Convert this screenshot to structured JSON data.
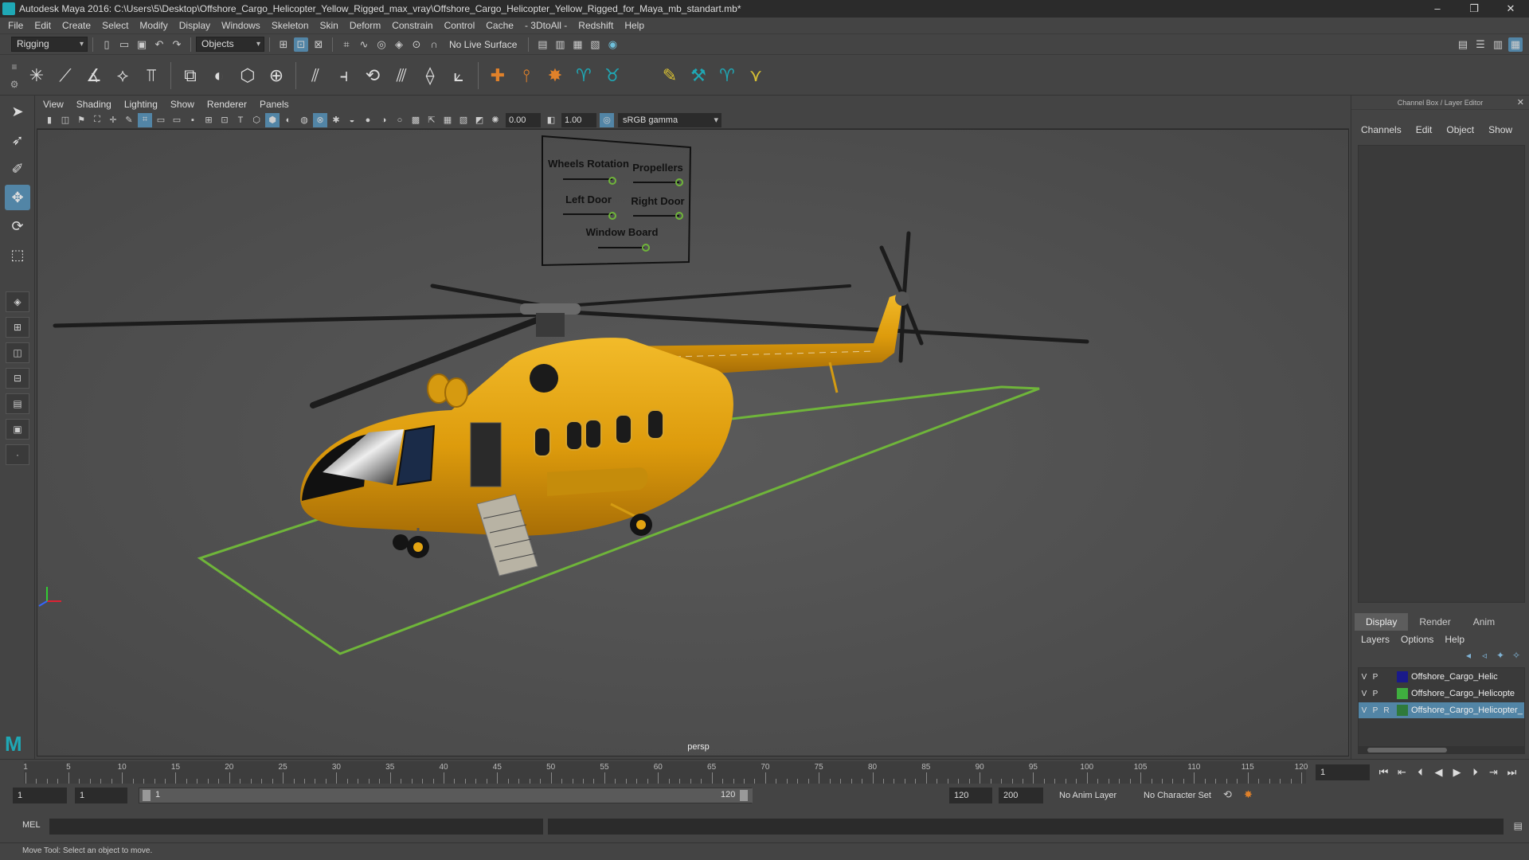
{
  "window": {
    "title": "Autodesk Maya 2016: C:\\Users\\5\\Desktop\\Offshore_Cargo_Helicopter_Yellow_Rigged_max_vray\\Offshore_Cargo_Helicopter_Yellow_Rigged_for_Maya_mb_standart.mb*",
    "minimize": "–",
    "maximize": "❐",
    "close": "✕"
  },
  "menus": [
    "File",
    "Edit",
    "Create",
    "Select",
    "Modify",
    "Display",
    "Windows",
    "Skeleton",
    "Skin",
    "Deform",
    "Constrain",
    "Control",
    "Cache",
    "- 3DtoAll -",
    "Redshift",
    "Help"
  ],
  "statusline": {
    "menuset": "Rigging",
    "selection_mode": "Objects",
    "live_surface": "No Live Surface"
  },
  "panel": {
    "menus": [
      "View",
      "Shading",
      "Lighting",
      "Show",
      "Renderer",
      "Panels"
    ],
    "exposure": "0.00",
    "gamma": "1.00",
    "colorspace": "sRGB gamma",
    "camera": "persp"
  },
  "controls_board": {
    "labels": [
      "Wheels Rotation",
      "Propellers",
      "Left Door",
      "Right Door",
      "Window Board"
    ]
  },
  "channel_box": {
    "header": "Channel Box / Layer Editor",
    "menus": [
      "Channels",
      "Edit",
      "Object",
      "Show"
    ]
  },
  "layer_editor": {
    "tabs": [
      "Display",
      "Render",
      "Anim"
    ],
    "active_tab": "Display",
    "menus": [
      "Layers",
      "Options",
      "Help"
    ],
    "layers": [
      {
        "v": "V",
        "p": "P",
        "r": "",
        "name": "Offshore_Cargo_Helic",
        "color": "#1a1a8a",
        "selected": false
      },
      {
        "v": "V",
        "p": "P",
        "r": "",
        "name": "Offshore_Cargo_Helicopte",
        "color": "#3fae3f",
        "selected": false
      },
      {
        "v": "V",
        "p": "P",
        "r": "R",
        "name": "Offshore_Cargo_Helicopter_",
        "color": "#2f7a3c",
        "selected": true
      }
    ]
  },
  "timeline": {
    "start": 1,
    "end": 120,
    "tick_labels": [
      "1",
      "5",
      "10",
      "15",
      "20",
      "25",
      "30",
      "35",
      "40",
      "45",
      "50",
      "55",
      "60",
      "65",
      "70",
      "75",
      "80",
      "85",
      "90",
      "95",
      "100",
      "105",
      "110",
      "115",
      "120"
    ],
    "current_frame": "1"
  },
  "range": {
    "start_field": "1",
    "start_field2": "1",
    "bar_start": "1",
    "bar_end": "120",
    "end_field": "120",
    "end_field2": "200",
    "anim_layer": "No Anim Layer",
    "character_set": "No Character Set"
  },
  "cmdline": {
    "label": "MEL"
  },
  "help": {
    "text": "Move Tool: Select an object to move."
  },
  "colors": {
    "accent": "#5285a6",
    "maya_teal": "#1fa8b5",
    "helicopter_yellow": "#e3a412",
    "rig_green": "#6fb53a"
  }
}
